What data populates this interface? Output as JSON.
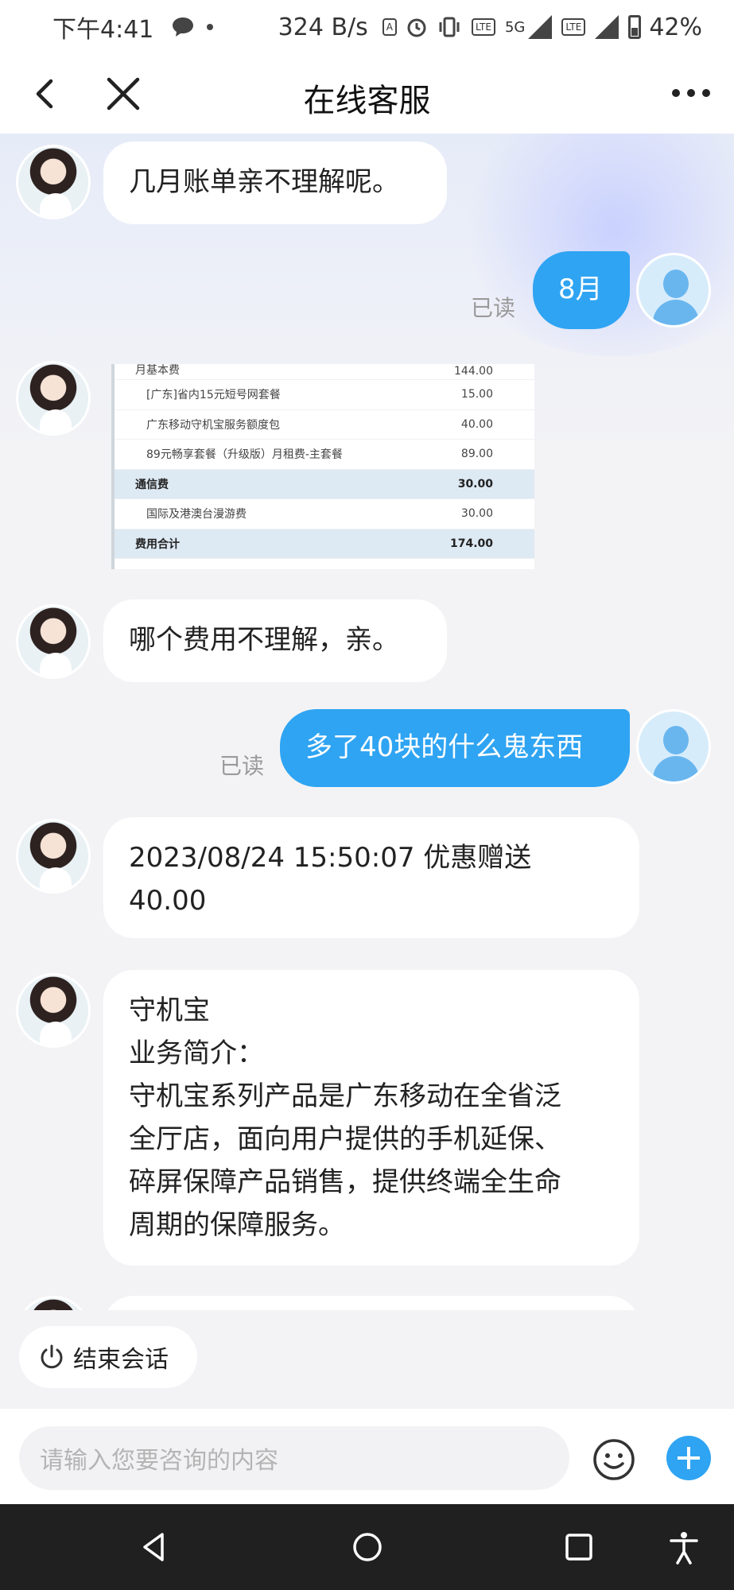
{
  "status_bar": {
    "time": "下午4:41",
    "speed": "324 B/s",
    "net_5g": "5G",
    "sim1": "1",
    "sim2": "2",
    "battery": "42%"
  },
  "header": {
    "title": "在线客服"
  },
  "messages": {
    "m1": {
      "text": "几月账单亲不理解呢。"
    },
    "m2": {
      "text": "8月",
      "status": "已读"
    },
    "bill": {
      "rows": [
        {
          "name": "月基本费",
          "amount": "144.00"
        },
        {
          "name": "[广东]省内15元短号网套餐",
          "amount": "15.00"
        },
        {
          "name": "广东移动守机宝服务额度包",
          "amount": "40.00"
        },
        {
          "name": "89元畅享套餐（升级版）月租费-主套餐",
          "amount": "89.00"
        },
        {
          "name": "通信费",
          "amount": "30.00"
        },
        {
          "name": "国际及港澳台漫游费",
          "amount": "30.00"
        },
        {
          "name": "费用合计",
          "amount": "174.00"
        }
      ]
    },
    "m3": {
      "text": "哪个费用不理解，亲。"
    },
    "m4": {
      "text": "多了40块的什么鬼东西",
      "status": "已读"
    },
    "m5": {
      "line1": "2023/08/24 15:50:07  优惠赠送",
      "line2": "40.00"
    },
    "m6": {
      "line1": "守机宝",
      "line2": "业务简介：",
      "line3": "守机宝系列产品是广东移动在全省泛",
      "line4": "全厅店，面向用户提供的手机延保、",
      "line5": "碎屏保障产品销售，提供终端全生命",
      "line6": "周期的保障服务。"
    }
  },
  "quick_actions": {
    "end_session": "结束会话"
  },
  "input": {
    "placeholder": "请输入您要咨询的内容"
  },
  "icons": {
    "accent": "#2fa4f2"
  }
}
